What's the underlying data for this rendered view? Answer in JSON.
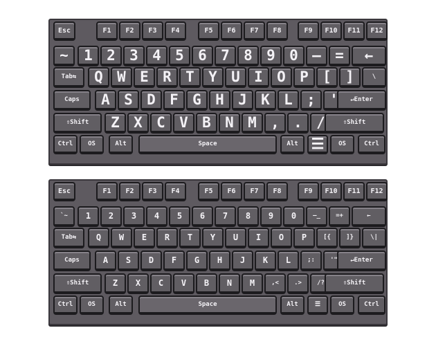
{
  "keyboards": [
    {
      "name": "full-legend",
      "rows": [
        [
          "Esc",
          "F1",
          "F2",
          "F3",
          "F4",
          "F5",
          "F6",
          "F7",
          "F8",
          "F9",
          "F10",
          "F11",
          "F12"
        ],
        [
          "~",
          "1",
          "2",
          "3",
          "4",
          "5",
          "6",
          "7",
          "8",
          "9",
          "0",
          "–",
          "=",
          "←"
        ],
        [
          "Tab⇆",
          "Q",
          "W",
          "E",
          "R",
          "T",
          "Y",
          "U",
          "I",
          "O",
          "P",
          "[",
          "]",
          "\\"
        ],
        [
          "Caps",
          "A",
          "S",
          "D",
          "F",
          "G",
          "H",
          "J",
          "K",
          "L",
          ";",
          "'",
          "↵Enter"
        ],
        [
          "⇧Shift",
          "Z",
          "X",
          "C",
          "V",
          "B",
          "N",
          "M",
          ",",
          ".",
          "/",
          "⇧Shift"
        ],
        [
          "Ctrl",
          "OS",
          "Alt",
          "Space",
          "Alt",
          "☰",
          "OS",
          "Ctrl"
        ]
      ]
    },
    {
      "name": "dual-legend",
      "rows": [
        [
          "Esc",
          "F1",
          "F2",
          "F3",
          "F4",
          "F5",
          "F6",
          "F7",
          "F8",
          "F9",
          "F10",
          "F11",
          "F12"
        ],
        [
          "`~",
          "1",
          "2",
          "3",
          "4",
          "5",
          "6",
          "7",
          "8",
          "9",
          "0",
          "–_",
          "=+",
          "←"
        ],
        [
          "Tab⇆",
          "Q",
          "W",
          "E",
          "R",
          "T",
          "Y",
          "U",
          "I",
          "O",
          "P",
          "[{",
          "]}",
          "\\|"
        ],
        [
          "Caps",
          "A",
          "S",
          "D",
          "F",
          "G",
          "H",
          "J",
          "K",
          "L",
          ";:",
          "'\"",
          "↵Enter"
        ],
        [
          "⇧Shift",
          "Z",
          "X",
          "C",
          "V",
          "B",
          "N",
          "M",
          ",<",
          ".>",
          "/?",
          "⇧Shift"
        ],
        [
          "Ctrl",
          "OS",
          "Alt",
          "Space",
          "Alt",
          "☰",
          "OS",
          "Ctrl"
        ]
      ]
    }
  ]
}
